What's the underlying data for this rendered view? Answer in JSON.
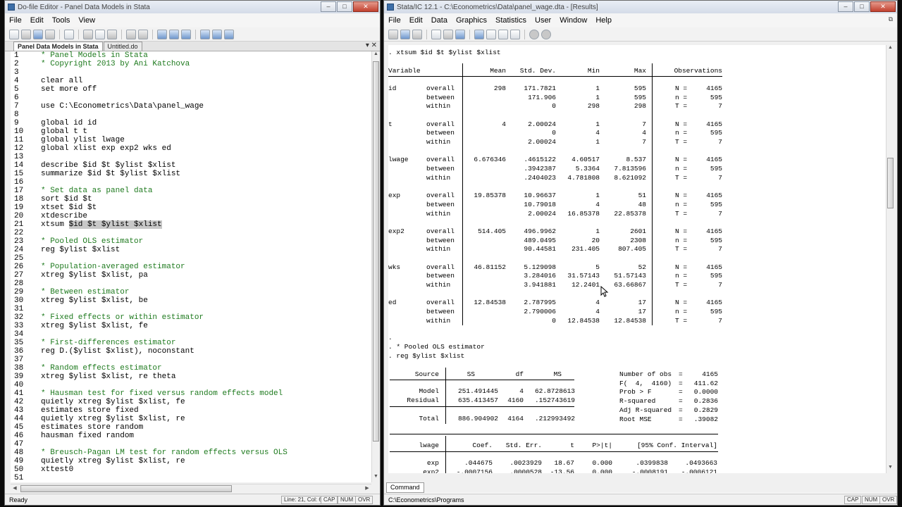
{
  "left_window": {
    "title": "Do-file Editor - Panel Data Models in Stata",
    "menu": [
      "File",
      "Edit",
      "Tools",
      "View"
    ],
    "tabs": [
      "Panel Data Models in Stata",
      "Untitled.do"
    ],
    "code_lines": [
      {
        "n": "1",
        "text": "* Panel Models in Stata",
        "kind": "comment"
      },
      {
        "n": "2",
        "text": "* Copyright 2013 by Ani Katchova",
        "kind": "comment"
      },
      {
        "n": "3",
        "text": "",
        "kind": "cmd"
      },
      {
        "n": "4",
        "text": "clear all",
        "kind": "cmd"
      },
      {
        "n": "5",
        "text": "set more off",
        "kind": "cmd"
      },
      {
        "n": "6",
        "text": "",
        "kind": "cmd"
      },
      {
        "n": "7",
        "text": "use C:\\Econometrics\\Data\\panel_wage",
        "kind": "cmd"
      },
      {
        "n": "8",
        "text": "",
        "kind": "cmd"
      },
      {
        "n": "9",
        "text": "global id id",
        "kind": "cmd"
      },
      {
        "n": "10",
        "text": "global t t",
        "kind": "cmd"
      },
      {
        "n": "11",
        "text": "global ylist lwage",
        "kind": "cmd"
      },
      {
        "n": "12",
        "text": "global xlist exp exp2 wks ed",
        "kind": "cmd"
      },
      {
        "n": "13",
        "text": "",
        "kind": "cmd"
      },
      {
        "n": "14",
        "text": "describe $id $t $ylist $xlist",
        "kind": "cmd"
      },
      {
        "n": "15",
        "text": "summarize $id $t $ylist $xlist",
        "kind": "cmd"
      },
      {
        "n": "16",
        "text": "",
        "kind": "cmd"
      },
      {
        "n": "17",
        "text": "* Set data as panel data",
        "kind": "comment"
      },
      {
        "n": "18",
        "text": "sort $id $t",
        "kind": "cmd"
      },
      {
        "n": "19",
        "text": "xtset $id $t",
        "kind": "cmd"
      },
      {
        "n": "20",
        "text": "xtdescribe",
        "kind": "cmd"
      },
      {
        "n": "21",
        "text": "xtsum ",
        "sel": "$id $t $ylist $xlist",
        "kind": "cmd"
      },
      {
        "n": "22",
        "text": "",
        "kind": "cmd"
      },
      {
        "n": "23",
        "text": "* Pooled OLS estimator",
        "kind": "comment"
      },
      {
        "n": "24",
        "text": "reg $ylist $xlist",
        "kind": "cmd"
      },
      {
        "n": "25",
        "text": "",
        "kind": "cmd"
      },
      {
        "n": "26",
        "text": "* Population-averaged estimator",
        "kind": "comment"
      },
      {
        "n": "27",
        "text": "xtreg $ylist $xlist, pa",
        "kind": "cmd"
      },
      {
        "n": "28",
        "text": "",
        "kind": "cmd"
      },
      {
        "n": "29",
        "text": "* Between estimator",
        "kind": "comment"
      },
      {
        "n": "30",
        "text": "xtreg $ylist $xlist, be",
        "kind": "cmd"
      },
      {
        "n": "31",
        "text": "",
        "kind": "cmd"
      },
      {
        "n": "32",
        "text": "* Fixed effects or within estimator",
        "kind": "comment"
      },
      {
        "n": "33",
        "text": "xtreg $ylist $xlist, fe",
        "kind": "cmd"
      },
      {
        "n": "34",
        "text": "",
        "kind": "cmd"
      },
      {
        "n": "35",
        "text": "* First-differences estimator",
        "kind": "comment"
      },
      {
        "n": "36",
        "text": "reg D.($ylist $xlist), noconstant",
        "kind": "cmd"
      },
      {
        "n": "37",
        "text": "",
        "kind": "cmd"
      },
      {
        "n": "38",
        "text": "* Random effects estimator",
        "kind": "comment"
      },
      {
        "n": "39",
        "text": "xtreg $ylist $xlist, re theta",
        "kind": "cmd"
      },
      {
        "n": "40",
        "text": "",
        "kind": "cmd"
      },
      {
        "n": "41",
        "text": "* Hausman test for fixed versus random effects model",
        "kind": "comment"
      },
      {
        "n": "42",
        "text": "quietly xtreg $ylist $xlist, fe",
        "kind": "cmd"
      },
      {
        "n": "43",
        "text": "estimates store fixed",
        "kind": "cmd"
      },
      {
        "n": "44",
        "text": "quietly xtreg $ylist $xlist, re",
        "kind": "cmd"
      },
      {
        "n": "45",
        "text": "estimates store random",
        "kind": "cmd"
      },
      {
        "n": "46",
        "text": "hausman fixed random",
        "kind": "cmd"
      },
      {
        "n": "47",
        "text": "",
        "kind": "cmd"
      },
      {
        "n": "48",
        "text": "* Breusch-Pagan LM test for random effects versus OLS",
        "kind": "comment"
      },
      {
        "n": "49",
        "text": "quietly xtreg $ylist $xlist, re",
        "kind": "cmd"
      },
      {
        "n": "50",
        "text": "xttest0",
        "kind": "cmd"
      },
      {
        "n": "51",
        "text": "",
        "kind": "cmd"
      }
    ],
    "status": {
      "ready": "Ready",
      "position": "Line: 21, Col: 6",
      "cap": "CAP",
      "num": "NUM",
      "ovr": "OVR"
    }
  },
  "right_window": {
    "title": "Stata/IC 12.1 - C:\\Econometrics\\Data\\panel_wage.dta - [Results]",
    "menu": [
      "File",
      "Edit",
      "Data",
      "Graphics",
      "Statistics",
      "User",
      "Window",
      "Help"
    ],
    "xtsum": {
      "command": ". xtsum $id $t $ylist $xlist",
      "headers": [
        "Variable",
        "Mean",
        "Std. Dev.",
        "Min",
        "Max",
        "Observations"
      ],
      "blocks": [
        {
          "var": "id",
          "rows": [
            [
              "overall",
              "298",
              "171.7821",
              "1",
              "595",
              "N =",
              "4165"
            ],
            [
              "between",
              "",
              "171.906",
              "1",
              "595",
              "n =",
              "595"
            ],
            [
              "within",
              "",
              "0",
              "298",
              "298",
              "T =",
              "7"
            ]
          ]
        },
        {
          "var": "t",
          "rows": [
            [
              "overall",
              "4",
              "2.00024",
              "1",
              "7",
              "N =",
              "4165"
            ],
            [
              "between",
              "",
              "0",
              "4",
              "4",
              "n =",
              "595"
            ],
            [
              "within",
              "",
              "2.00024",
              "1",
              "7",
              "T =",
              "7"
            ]
          ]
        },
        {
          "var": "lwage",
          "rows": [
            [
              "overall",
              "6.676346",
              ".4615122",
              "4.60517",
              "8.537",
              "N =",
              "4165"
            ],
            [
              "between",
              "",
              ".3942387",
              "5.3364",
              "7.813596",
              "n =",
              "595"
            ],
            [
              "within",
              "",
              ".2404023",
              "4.781808",
              "8.621092",
              "T =",
              "7"
            ]
          ]
        },
        {
          "var": "exp",
          "rows": [
            [
              "overall",
              "19.85378",
              "10.96637",
              "1",
              "51",
              "N =",
              "4165"
            ],
            [
              "between",
              "",
              "10.79018",
              "4",
              "48",
              "n =",
              "595"
            ],
            [
              "within",
              "",
              "2.00024",
              "16.85378",
              "22.85378",
              "T =",
              "7"
            ]
          ]
        },
        {
          "var": "exp2",
          "rows": [
            [
              "overall",
              "514.405",
              "496.9962",
              "1",
              "2601",
              "N =",
              "4165"
            ],
            [
              "between",
              "",
              "489.0495",
              "20",
              "2308",
              "n =",
              "595"
            ],
            [
              "within",
              "",
              "90.44581",
              "231.405",
              "807.405",
              "T =",
              "7"
            ]
          ]
        },
        {
          "var": "wks",
          "rows": [
            [
              "overall",
              "46.81152",
              "5.129098",
              "5",
              "52",
              "N =",
              "4165"
            ],
            [
              "between",
              "",
              "3.284016",
              "31.57143",
              "51.57143",
              "n =",
              "595"
            ],
            [
              "within",
              "",
              "3.941881",
              "12.2401",
              "63.66867",
              "T =",
              "7"
            ]
          ]
        },
        {
          "var": "ed",
          "rows": [
            [
              "overall",
              "12.84538",
              "2.787995",
              "4",
              "17",
              "N =",
              "4165"
            ],
            [
              "between",
              "",
              "2.790006",
              "4",
              "17",
              "n =",
              "595"
            ],
            [
              "within",
              "",
              "0",
              "12.84538",
              "12.84538",
              "T =",
              "7"
            ]
          ]
        }
      ]
    },
    "dot_line": ".",
    "pooled_comment": ". * Pooled OLS estimator",
    "reg_command": ". reg $ylist $xlist",
    "anova": {
      "headers": [
        "Source",
        "SS",
        "df",
        "MS"
      ],
      "rows": [
        [
          "Model",
          "251.491445",
          "4",
          "62.8728613"
        ],
        [
          "Residual",
          "635.413457",
          "4160",
          ".152743619"
        ]
      ],
      "total": [
        "Total",
        "886.904902",
        "4164",
        ".212993492"
      ]
    },
    "fit_stats": [
      [
        "Number of obs",
        "=",
        "4165"
      ],
      [
        "F(  4,  4160)",
        "=",
        "411.62"
      ],
      [
        "Prob > F",
        "=",
        "0.0000"
      ],
      [
        "R-squared",
        "=",
        "0.2836"
      ],
      [
        "Adj R-squared",
        "=",
        "0.2829"
      ],
      [
        "Root MSE",
        "=",
        ".39082"
      ]
    ],
    "coef_table": {
      "depvar": "lwage",
      "headers": [
        "Coef.",
        "Std. Err.",
        "t",
        "P>|t|",
        "[95% Conf. Interval]"
      ],
      "rows": [
        [
          "exp",
          ".044675",
          ".0023929",
          "18.67",
          "0.000",
          ".0399838",
          ".0493663"
        ],
        [
          "exp2",
          "-.0007156",
          ".0000528",
          "-13.56",
          "0.000",
          "-.0008191",
          "-.0006121"
        ]
      ]
    },
    "command_tab": "Command",
    "status": {
      "path": "C:\\Econometrics\\Programs",
      "cap": "CAP",
      "num": "NUM",
      "ovr": "OVR"
    }
  }
}
